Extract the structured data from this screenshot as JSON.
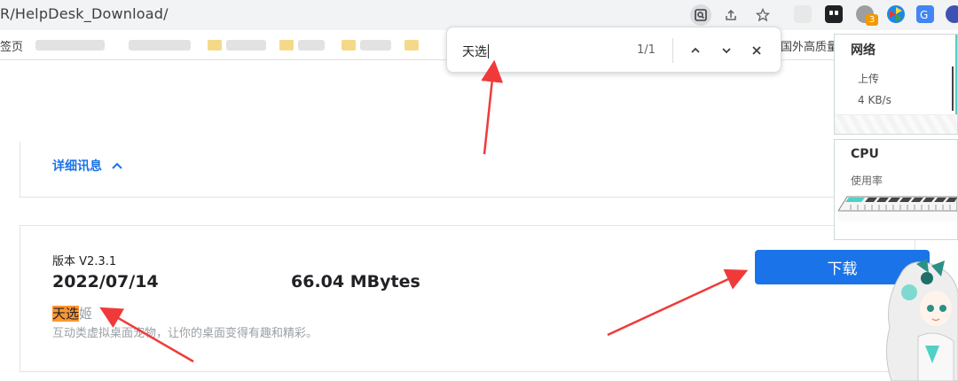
{
  "browser": {
    "url": "R/HelpDesk_Download/",
    "extension_badge": "3",
    "bookmarks": {
      "first_label": "签页",
      "last_label": "国外高质量"
    }
  },
  "find_bar": {
    "query": "天选",
    "count": "1/1"
  },
  "page": {
    "details_link": "详细讯息",
    "version_label": "版本 V2.3.1",
    "release_date": "2022/07/14",
    "file_size": "66.04 MBytes",
    "app_name_highlight": "天选",
    "app_name_rest": "姬",
    "app_description": "互动类虚拟桌面宠物，让你的桌面变得有趣和精彩。",
    "download_button": "下载"
  },
  "widgets": {
    "network": {
      "title": "网络",
      "upload_label": "上传",
      "upload_value": "4 KB/s"
    },
    "cpu": {
      "title": "CPU",
      "usage_label": "使用率"
    }
  },
  "colors": {
    "accent": "#1a73e8",
    "find_highlight": "#ff9632",
    "arrow": "#f03a3a",
    "widget_accent": "#4fd1c5"
  }
}
